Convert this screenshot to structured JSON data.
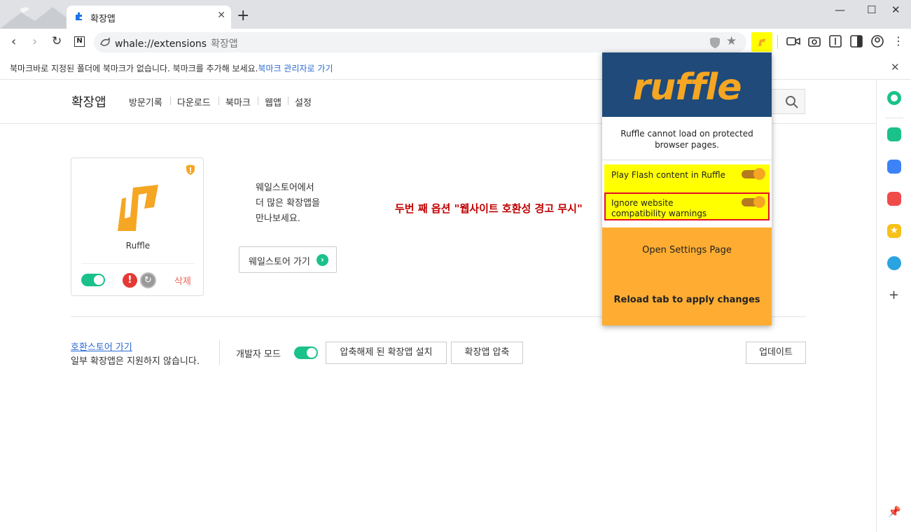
{
  "tab": {
    "title": "확장앱"
  },
  "omnibox": {
    "url": "whale://extensions",
    "page_label": "확장앱"
  },
  "bookmark_bar": {
    "message": "북마크바로 지정된 폴더에 북마크가 없습니다. 북마크를 추가해 보세요.",
    "link": "북마크 관리자로 가기"
  },
  "header": {
    "title": "확장앱",
    "nav": [
      "방문기록",
      "다운로드",
      "북마크",
      "웹앱",
      "설정"
    ]
  },
  "extension_card": {
    "name": "Ruffle",
    "enabled": true,
    "delete_label": "삭제"
  },
  "store_promo": {
    "line1": "웨일스토어에서",
    "line2": "더 많은 확장앱을",
    "line3": "만나보세요.",
    "button": "웨일스토어 가기"
  },
  "annotation": "두번 째 옵션 \"웹사이트 호환성 경고 무시\"",
  "footer": {
    "compat_link": "호환스토어 가기",
    "compat_note": "일부 확장앱은 지원하지 않습니다.",
    "dev_mode_label": "개발자 모드",
    "dev_mode_on": true,
    "load_unpacked": "압축해제 된 확장앱 설치",
    "pack": "확장앱 압축",
    "update": "업데이트"
  },
  "popup": {
    "logo_text": "ruffle",
    "message_line1": "Ruffle cannot load on protected",
    "message_line2": "browser pages.",
    "options": [
      {
        "label": "Play Flash content in Ruffle",
        "on": true
      },
      {
        "label": "Ignore website compatibility warnings",
        "on": true
      }
    ],
    "settings_label": "Open Settings Page",
    "reload_label": "Reload tab to apply changes"
  },
  "colors": {
    "accent": "#1ac18b",
    "ruffle_blue": "#1f4a7a",
    "ruffle_orange": "#ffad32",
    "highlight": "#ffff00",
    "annotation": "#c00000"
  }
}
